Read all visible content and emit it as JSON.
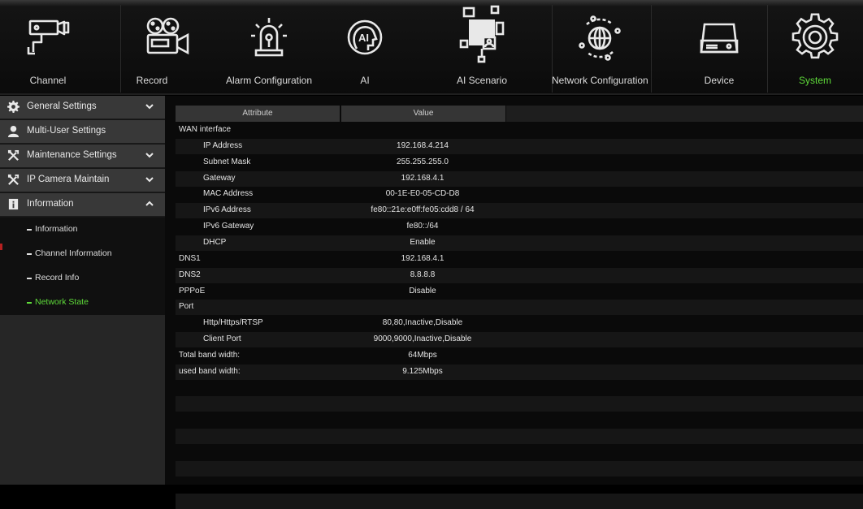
{
  "nav": [
    {
      "label": "Channel",
      "icon": "camera-icon",
      "active": false
    },
    {
      "label": "Record",
      "icon": "film-camera-icon",
      "active": false
    },
    {
      "label": "Alarm Configuration",
      "icon": "alarm-siren-icon",
      "active": false
    },
    {
      "label": "AI",
      "icon": "ai-head-icon",
      "active": false
    },
    {
      "label": "AI Scenario",
      "icon": "ai-scenario-icon",
      "active": false
    },
    {
      "label": "Network Configuration",
      "icon": "globe-network-icon",
      "active": false
    },
    {
      "label": "Device",
      "icon": "hard-drive-icon",
      "active": false
    },
    {
      "label": "System",
      "icon": "gear-icon",
      "active": true
    }
  ],
  "sidebar": {
    "sections": [
      {
        "label": "General Settings",
        "icon": "gear-icon",
        "chevron": "down"
      },
      {
        "label": "Multi-User Settings",
        "icon": "user-icon",
        "chevron": ""
      },
      {
        "label": "Maintenance Settings",
        "icon": "tools-icon",
        "chevron": "down"
      },
      {
        "label": "IP Camera Maintain",
        "icon": "tools-icon",
        "chevron": "down"
      },
      {
        "label": "Information",
        "icon": "info-book-icon",
        "chevron": "up"
      }
    ],
    "subitems": [
      {
        "label": "Information",
        "active": false
      },
      {
        "label": "Channel Information",
        "active": false
      },
      {
        "label": "Record Info",
        "active": false
      },
      {
        "label": "Network State",
        "active": true
      }
    ]
  },
  "table": {
    "headers": [
      "Attribute",
      "Value"
    ],
    "rows": [
      {
        "attr": "WAN interface",
        "value": "",
        "indent": false
      },
      {
        "attr": "IP Address",
        "value": "192.168.4.214",
        "indent": true
      },
      {
        "attr": "Subnet Mask",
        "value": "255.255.255.0",
        "indent": true
      },
      {
        "attr": "Gateway",
        "value": "192.168.4.1",
        "indent": true
      },
      {
        "attr": "MAC Address",
        "value": "00-1E-E0-05-CD-D8",
        "indent": true
      },
      {
        "attr": "IPv6 Address",
        "value": "fe80::21e:e0ff:fe05:cdd8 / 64",
        "indent": true
      },
      {
        "attr": "IPv6 Gateway",
        "value": "fe80::/64",
        "indent": true
      },
      {
        "attr": "DHCP",
        "value": "Enable",
        "indent": true
      },
      {
        "attr": "DNS1",
        "value": "192.168.4.1",
        "indent": false
      },
      {
        "attr": "DNS2",
        "value": "8.8.8.8",
        "indent": false
      },
      {
        "attr": "PPPoE",
        "value": "Disable",
        "indent": false
      },
      {
        "attr": "Port",
        "value": "",
        "indent": false
      },
      {
        "attr": "Http/Https/RTSP",
        "value": "80,80,Inactive,Disable",
        "indent": true
      },
      {
        "attr": "Client Port",
        "value": "9000,9000,Inactive,Disable",
        "indent": true
      },
      {
        "attr": "Total band width:",
        "value": "64Mbps",
        "indent": false
      },
      {
        "attr": "used band width:",
        "value": "9.125Mbps",
        "indent": false
      },
      {
        "attr": "",
        "value": "",
        "indent": false
      },
      {
        "attr": "",
        "value": "",
        "indent": false
      },
      {
        "attr": "",
        "value": "",
        "indent": false
      },
      {
        "attr": "",
        "value": "",
        "indent": false
      },
      {
        "attr": "",
        "value": "",
        "indent": false
      },
      {
        "attr": "",
        "value": "",
        "indent": false
      },
      {
        "attr": "",
        "value": "",
        "indent": false
      },
      {
        "attr": "",
        "value": "",
        "indent": false
      }
    ]
  },
  "colors": {
    "accent": "#5fdc3a",
    "header": "#353535",
    "sidebar_item": "#383838"
  }
}
